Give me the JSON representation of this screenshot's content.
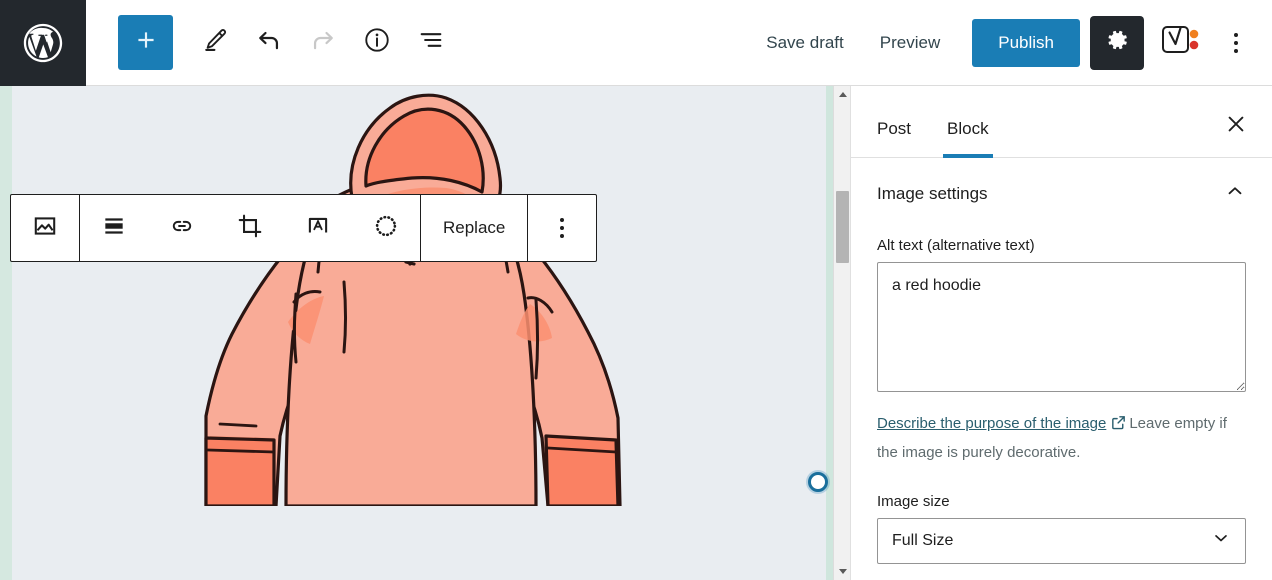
{
  "topbar": {
    "logo_icon": "wordpress-logo",
    "add_block_label": "+",
    "icons": [
      "add-block-icon",
      "edit-pencil-icon",
      "undo-icon",
      "redo-icon",
      "info-icon",
      "list-view-icon"
    ],
    "save_draft_label": "Save draft",
    "preview_label": "Preview",
    "publish_label": "Publish",
    "settings_icon": "gear-icon",
    "yoast_icon": "yoast-seo-icon",
    "more_icon": "kebab-menu-icon",
    "accent_blue": "#1a7db5",
    "dark_bar": "#23282d"
  },
  "block_toolbar": {
    "block_type_icon": "image-block-icon",
    "align_icon": "align-center-icon",
    "link_icon": "link-icon",
    "crop_icon": "crop-icon",
    "text_over_image_icon": "text-over-image-icon",
    "duotone_icon": "duotone-filter-icon",
    "replace_label": "Replace",
    "more_icon": "kebab-menu-icon"
  },
  "canvas": {
    "image_alt": "a red hoodie",
    "background_color": "#e9edf1",
    "selection_color": "#d5e8e0",
    "resize_handle": "image-resize-handle",
    "scrollbar": "vertical-scrollbar"
  },
  "sidebar": {
    "tabs": [
      {
        "label": "Post",
        "active": false
      },
      {
        "label": "Block",
        "active": true
      }
    ],
    "close_icon": "close-icon",
    "panel": {
      "title": "Image settings",
      "collapse_icon": "chevron-up-icon",
      "alt_label": "Alt text (alternative text)",
      "alt_value": "a red hoodie",
      "alt_placeholder": "",
      "help_link": "Describe the purpose of the image",
      "help_link_icon": "external-link-icon",
      "help_text": "Leave empty if the image is purely decorative.",
      "size_label": "Image size",
      "size_value": "Full Size",
      "size_chevron_icon": "chevron-down-icon"
    }
  }
}
